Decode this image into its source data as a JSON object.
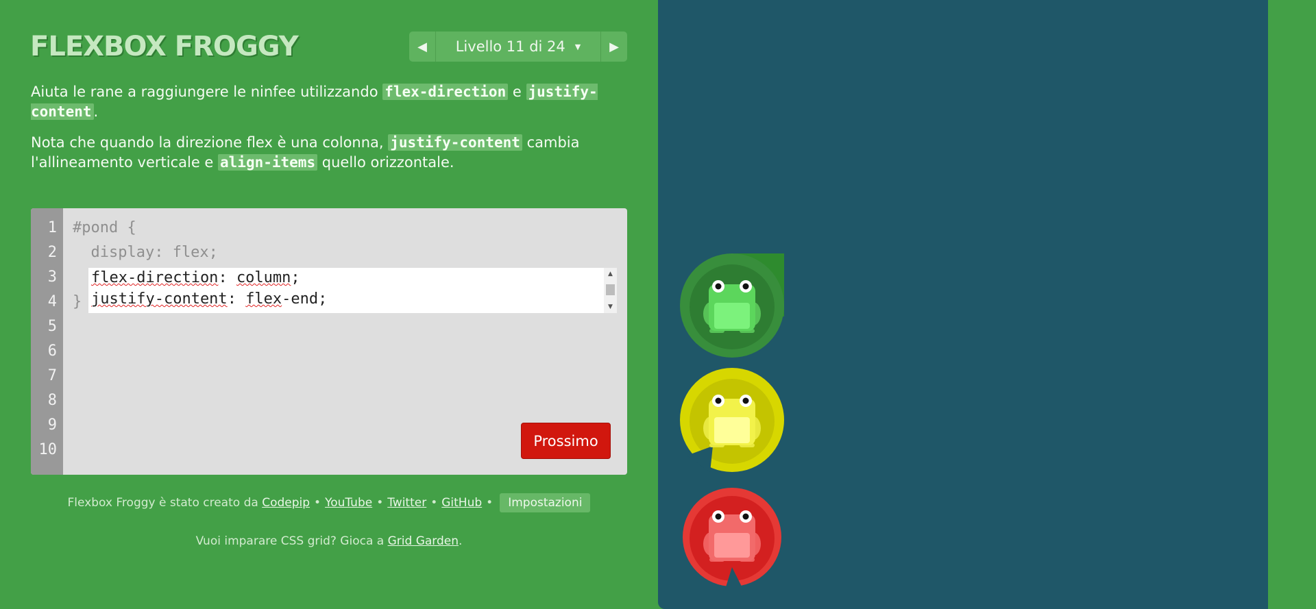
{
  "game": {
    "title": "FLEXBOX FROGGY"
  },
  "level_nav": {
    "prev_icon": "triangle-left-icon",
    "label": "Livello 11 di 24",
    "caret": "▼",
    "next_icon": "triangle-right-icon"
  },
  "instructions": {
    "p1": {
      "before": "Aiuta le rane a raggiungere le ninfee utilizzando ",
      "code1": "flex-direction",
      "middle": " e ",
      "code2": "justify-content",
      "after": "."
    },
    "p2": {
      "before": "Nota che quando la direzione flex è una colonna, ",
      "code1": "justify-content",
      "middle": " cambia l'allineamento verticale e ",
      "code2": "align-items",
      "after": " quello orizzontale."
    }
  },
  "editor": {
    "line_numbers": [
      "1",
      "2",
      "3",
      "4",
      "5",
      "6",
      "7",
      "8",
      "9",
      "10"
    ],
    "line1": "#pond {",
    "line2": "  display: flex;",
    "line5": "}",
    "input": {
      "line3": {
        "prop": "flex-direction",
        "rest": ": ",
        "value": "column",
        "end": ";"
      },
      "line4": {
        "prop": "justify-content",
        "rest": ": ",
        "value_sp": "flex",
        "value_rest": "-end;"
      }
    },
    "next_button": "Prossimo"
  },
  "credits": {
    "text": "Flexbox Froggy è stato creato da",
    "links": [
      "Codepip",
      "YouTube",
      "Twitter",
      "GitHub"
    ],
    "separator": "•",
    "settings": "Impostazioni"
  },
  "grid_garden": {
    "text": "Vuoi imparare CSS grid? Gioca a ",
    "link": "Grid Garden",
    "after": "."
  },
  "colors": {
    "background": "#43a047",
    "pond": "#1f5768",
    "next_button": "#d1170e"
  },
  "frogs": [
    {
      "color": "green",
      "pad": "#2e8b2e"
    },
    {
      "color": "yellow",
      "pad": "#c8c800"
    },
    {
      "color": "red",
      "pad": "#d32020"
    }
  ]
}
